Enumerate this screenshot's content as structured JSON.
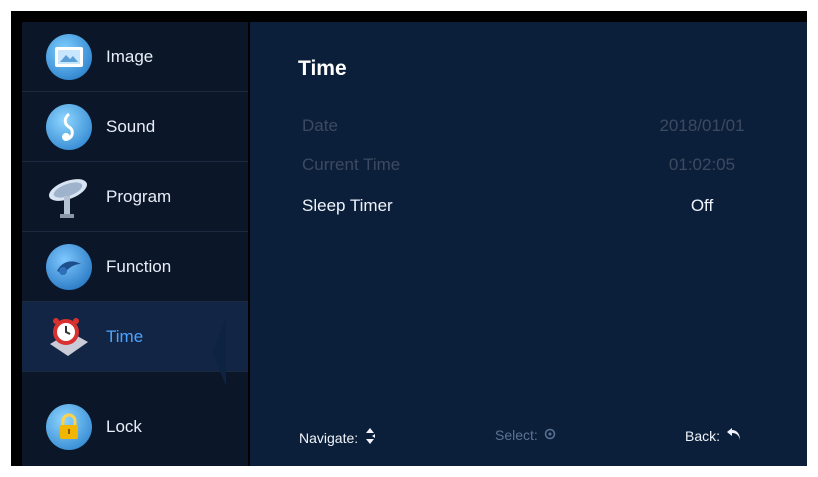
{
  "sidebar": {
    "items": [
      {
        "label": "Image",
        "icon": "image-icon"
      },
      {
        "label": "Sound",
        "icon": "music-note-icon"
      },
      {
        "label": "Program",
        "icon": "satellite-dish-icon"
      },
      {
        "label": "Function",
        "icon": "globe-icon"
      },
      {
        "label": "Time",
        "icon": "clock-icon"
      },
      {
        "label": "Lock",
        "icon": "lock-icon"
      }
    ],
    "active": "Time"
  },
  "main": {
    "title": "Time",
    "rows": [
      {
        "name": "Date",
        "value": "2018/01/01",
        "enabled": false
      },
      {
        "name": "Current Time",
        "value": "01:02:05",
        "enabled": false
      },
      {
        "name": "Sleep Timer",
        "value": "Off",
        "enabled": true
      }
    ]
  },
  "footer": {
    "navigate": "Navigate:",
    "select": "Select:",
    "back": "Back:"
  },
  "colors": {
    "sidebar_bg": "#0b1628",
    "main_bg": "#0c1f3a",
    "active_text": "#4da3ff",
    "dim_text": "#3c4a60"
  }
}
